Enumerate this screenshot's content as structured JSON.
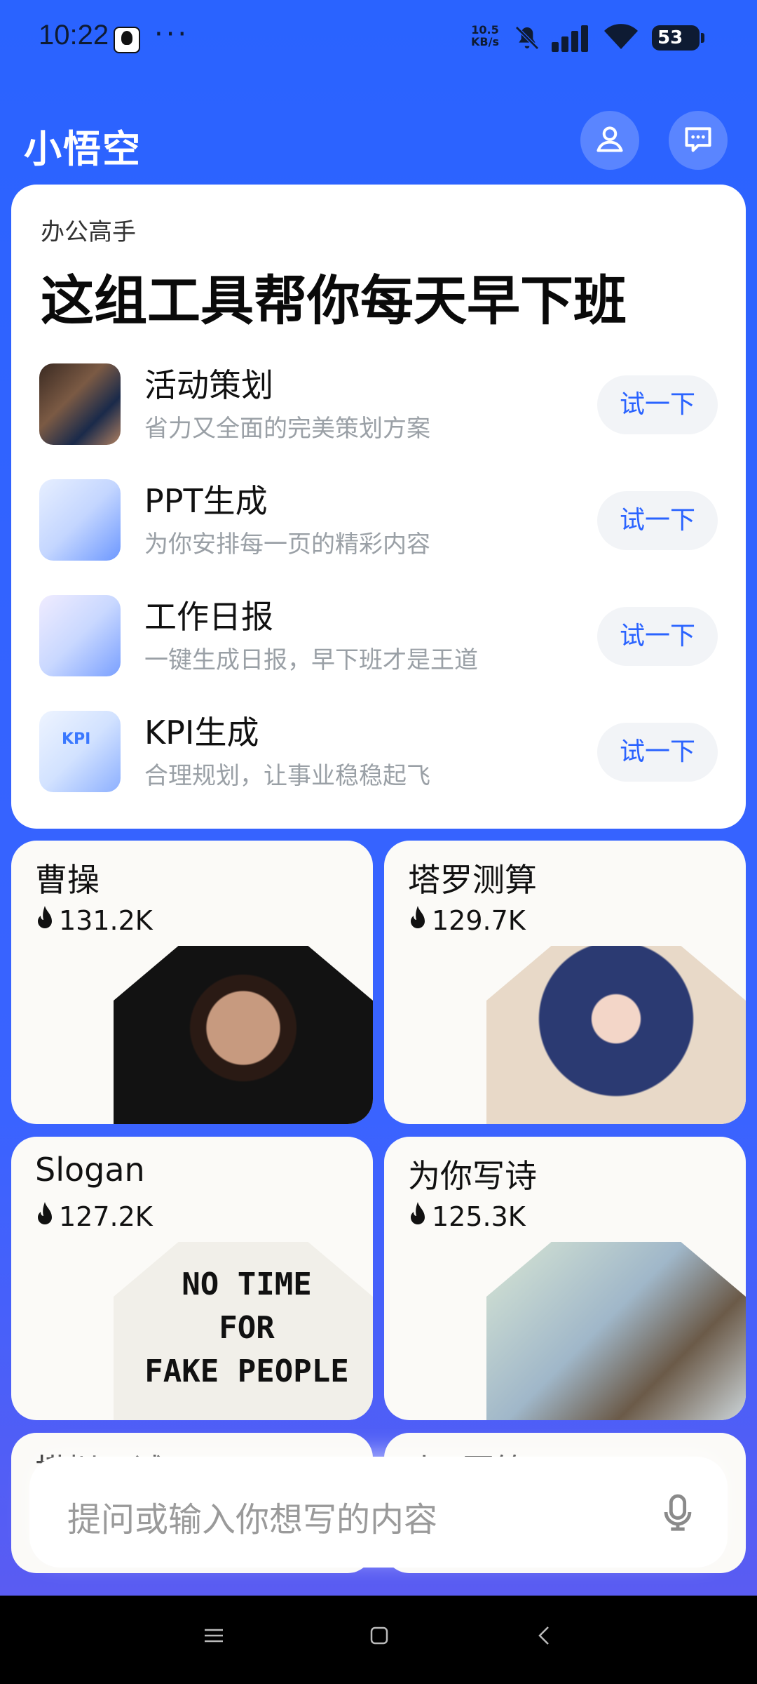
{
  "status_bar": {
    "time": "10:22",
    "dots": "···",
    "speed_value": "10.5",
    "speed_unit": "KB/s",
    "battery": "53"
  },
  "header": {
    "title": "小悟空"
  },
  "office_card": {
    "tag": "办公高手",
    "headline": "这组工具帮你每天早下班",
    "tools": [
      {
        "name": "活动策划",
        "desc": "省力又全面的完美策划方案",
        "button": "试一下"
      },
      {
        "name": "PPT生成",
        "desc": "为你安排每一页的精彩内容",
        "button": "试一下"
      },
      {
        "name": "工作日报",
        "desc": "一键生成日报，早下班才是王道",
        "button": "试一下"
      },
      {
        "name": "KPI生成",
        "desc": "合理规划，让事业稳稳起飞",
        "button": "试一下",
        "thumb_text": "KPI"
      }
    ]
  },
  "characters": [
    {
      "name": "曹操",
      "count": "131.2K"
    },
    {
      "name": "塔罗测算",
      "count": "129.7K"
    },
    {
      "name": "Slogan",
      "count": "127.2K",
      "art_text": [
        "NO TIME",
        "FOR",
        "FAKE PEOPLE"
      ]
    },
    {
      "name": "为你写诗",
      "count": "125.3K"
    }
  ],
  "partial_cards": [
    {
      "name": "模拟面试"
    },
    {
      "name": "小X回答"
    }
  ],
  "input": {
    "placeholder": "提问或输入你想写的内容"
  },
  "colors": {
    "brand_blue": "#2a63ff",
    "button_text": "#2a63ff",
    "card_bg": "#ffffff"
  },
  "icons": {
    "profile": "person-icon",
    "message": "message-icon",
    "mic": "microphone-icon",
    "fire": "fire-icon"
  }
}
